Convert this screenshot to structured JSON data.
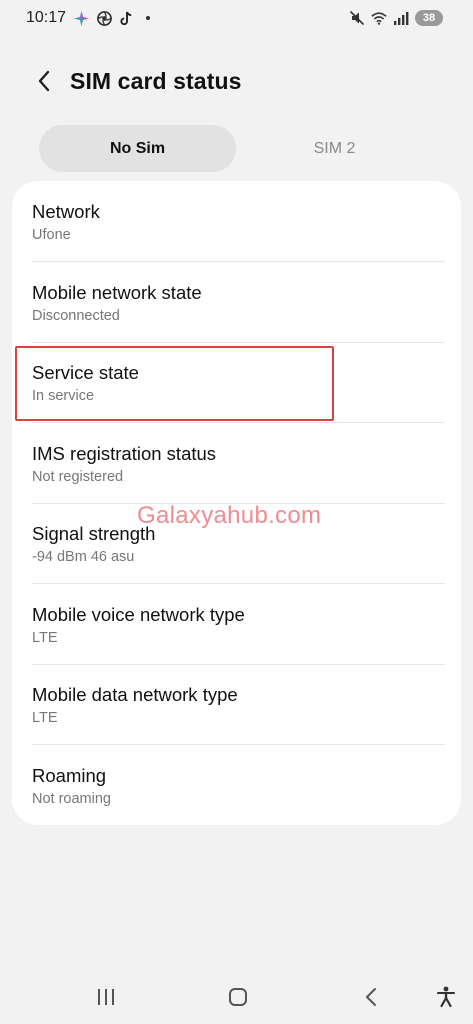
{
  "status_bar": {
    "time": "10:17",
    "battery": "38",
    "left_icons": [
      "sparkle-icon",
      "aperture-icon",
      "tiktok-icon"
    ],
    "right_icons": [
      "mute-icon",
      "wifi-icon",
      "signal-icon"
    ]
  },
  "header": {
    "title": "SIM card status"
  },
  "tabs": [
    {
      "label": "No Sim",
      "active": true
    },
    {
      "label": "SIM 2",
      "active": false
    }
  ],
  "items": [
    {
      "label": "Network",
      "value": "Ufone"
    },
    {
      "label": "Mobile network state",
      "value": "Disconnected"
    },
    {
      "label": "Service state",
      "value": "In service"
    },
    {
      "label": "IMS registration status",
      "value": "Not registered"
    },
    {
      "label": "Signal strength",
      "value": "-94 dBm 46 asu"
    },
    {
      "label": "Mobile voice network type",
      "value": "LTE"
    },
    {
      "label": "Mobile data network type",
      "value": "LTE"
    },
    {
      "label": "Roaming",
      "value": "Not roaming"
    }
  ],
  "watermark": "Galaxyahub.com",
  "colors": {
    "background": "#f2f2f2",
    "card": "#ffffff",
    "highlight": "#d9443c",
    "watermark": "#ef7f86"
  }
}
